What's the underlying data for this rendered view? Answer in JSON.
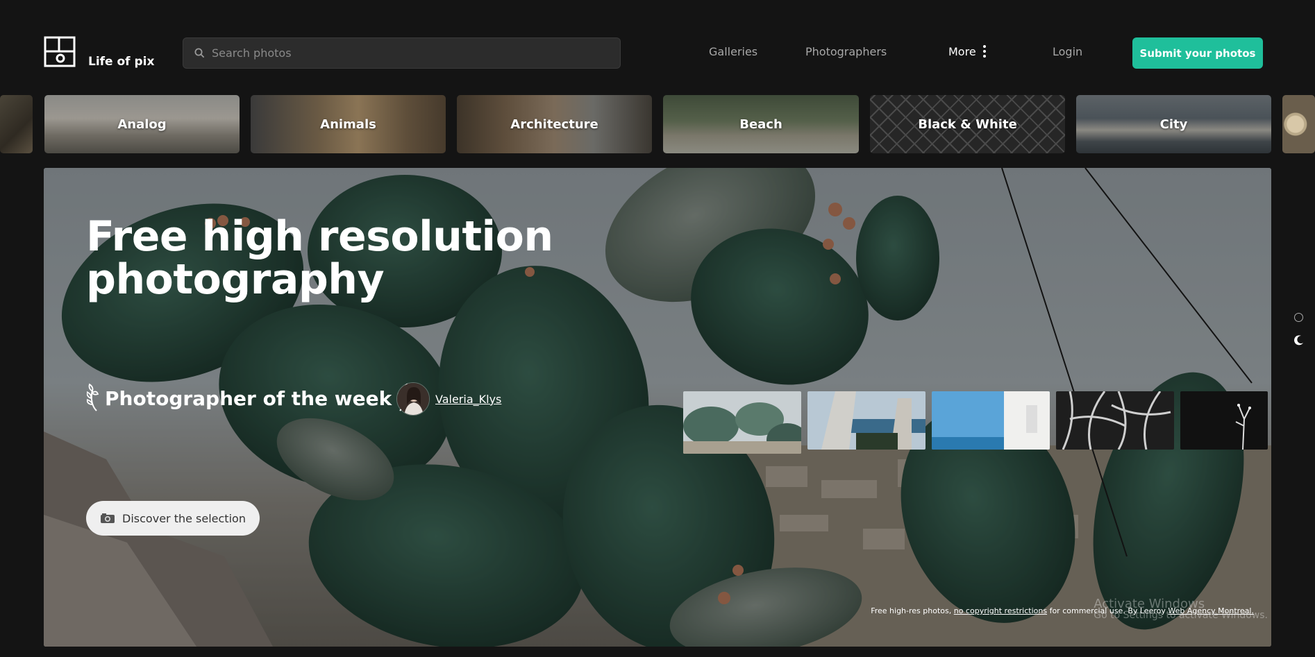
{
  "brand": {
    "name": "Life of pix"
  },
  "search": {
    "placeholder": "Search photos"
  },
  "nav": {
    "galleries": "Galleries",
    "photographers": "Photographers",
    "more": "More",
    "login": "Login",
    "submit": "Submit your photos"
  },
  "categories": [
    {
      "label": "Analog"
    },
    {
      "label": "Animals"
    },
    {
      "label": "Architecture"
    },
    {
      "label": "Beach"
    },
    {
      "label": "Black & White"
    },
    {
      "label": "City"
    }
  ],
  "hero": {
    "title_line1": "Free high resolution",
    "title_line2": "photography",
    "photographer_of_week": "Photographer of the week",
    "photographer_name": "Valeria_Klys",
    "discover_label": "Discover the selection",
    "credits": {
      "prefix": "Free high-res photos, ",
      "link1": "no copyright restrictions",
      "middle": " for commercial use. By Leeroy ",
      "link2": "Web Agency Montreal."
    }
  },
  "watermark": {
    "line1": "Activate Windows",
    "line2": "Go to Settings to activate Windows."
  },
  "colors": {
    "background": "#141414",
    "accent": "#1fbf9b",
    "search_bg": "#2c2c2c"
  },
  "icons": [
    "logo-icon",
    "search-icon",
    "more-dots-icon",
    "laurel-icon",
    "camera-icon",
    "theme-dot-icon",
    "moon-icon"
  ]
}
